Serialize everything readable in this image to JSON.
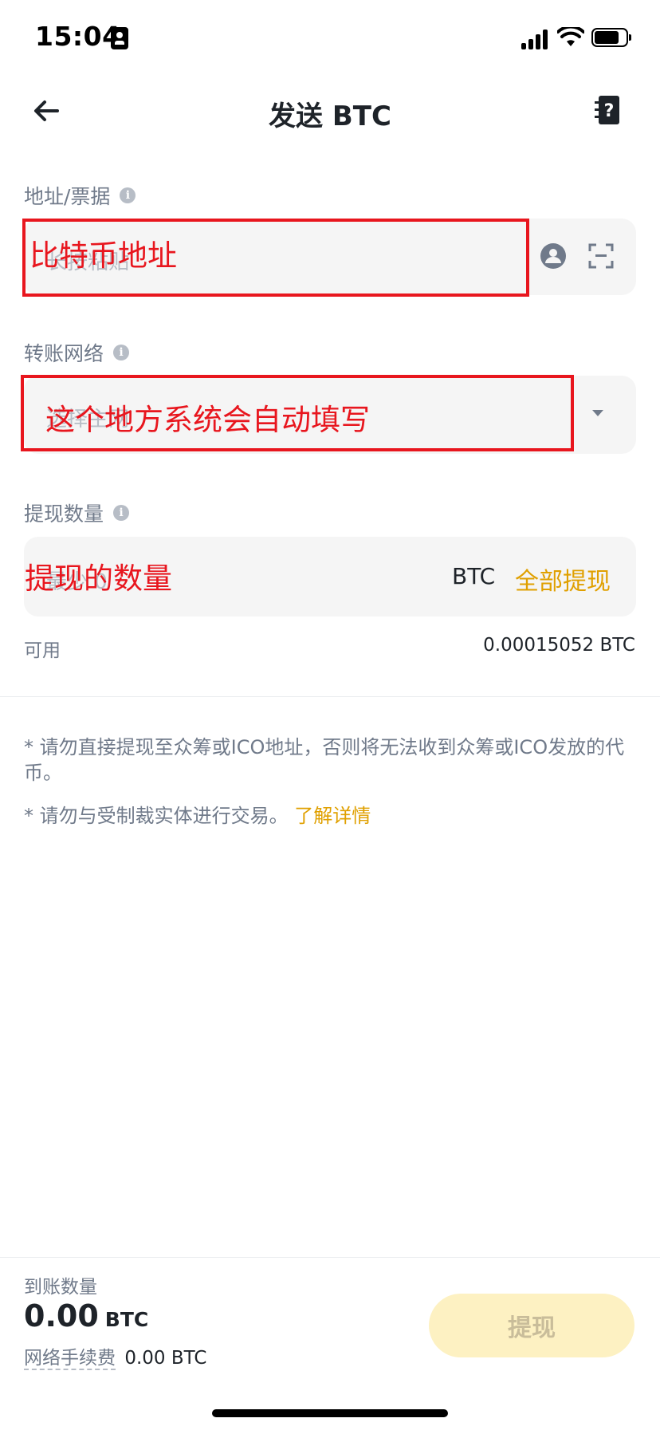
{
  "status_bar": {
    "time": "15:04"
  },
  "header": {
    "title": "发送 BTC"
  },
  "address_section": {
    "label": "地址/票据",
    "placeholder": "长按粘贴",
    "annotation": "比特币地址"
  },
  "network_section": {
    "label": "转账网络",
    "placeholder": "选择主网",
    "annotation": "这个地方系统会自动填写"
  },
  "amount_section": {
    "label": "提现数量",
    "placeholder": "最少 0",
    "annotation": "提现的数量",
    "unit": "BTC",
    "max_label": "全部提现",
    "available_label": "可用",
    "available_value": "0.00015052 BTC"
  },
  "notes": {
    "note1": "* 请勿直接提现至众筹或ICO地址，否则将无法收到众筹或ICO发放的代币。",
    "note2_prefix": "* 请勿与受制裁实体进行交易。",
    "note2_link": "了解详情"
  },
  "footer": {
    "receive_label": "到账数量",
    "receive_amount": "0.00",
    "receive_unit": "BTC",
    "fee_label": "网络手续费",
    "fee_value": "0.00 BTC",
    "submit_label": "提现"
  },
  "colors": {
    "accent": "#e0a000",
    "annotation_red": "#e8161e",
    "button_disabled_bg": "#fdf1c2"
  }
}
